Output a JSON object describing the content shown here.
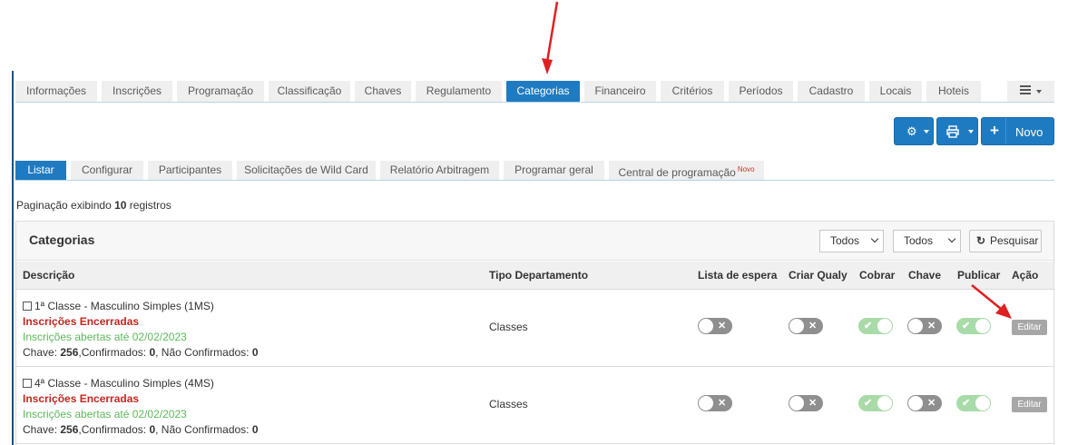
{
  "top_tabs": [
    {
      "label": "Informações",
      "active": false
    },
    {
      "label": "Inscrições",
      "active": false
    },
    {
      "label": "Programação",
      "active": false
    },
    {
      "label": "Classificação",
      "active": false
    },
    {
      "label": "Chaves",
      "active": false
    },
    {
      "label": "Regulamento",
      "active": false
    },
    {
      "label": "Categorias",
      "active": true
    },
    {
      "label": "Financeiro",
      "active": false
    },
    {
      "label": "Critérios",
      "active": false
    },
    {
      "label": "Períodos",
      "active": false
    },
    {
      "label": "Cadastro",
      "active": false
    },
    {
      "label": "Locais",
      "active": false
    },
    {
      "label": "Hoteis",
      "active": false
    }
  ],
  "toolbar": {
    "menu_icon": "hamburger-icon",
    "settings_icon": "gear-icon",
    "print_icon": "print-icon",
    "new_label": "Novo"
  },
  "sub_tabs": [
    {
      "label": "Listar",
      "active": true
    },
    {
      "label": "Configurar",
      "active": false
    },
    {
      "label": "Participantes",
      "active": false
    },
    {
      "label": "Solicitações de Wild Card",
      "active": false
    },
    {
      "label": "Relatório Arbitragem",
      "active": false
    },
    {
      "label": "Programar geral",
      "active": false
    },
    {
      "label": "Central de programação",
      "active": false,
      "badge": "Novo"
    }
  ],
  "pagination": {
    "prefix": "Paginação exibindo",
    "count": "10",
    "suffix": "registros"
  },
  "panel": {
    "title": "Categorias",
    "filter_1": "Todos",
    "filter_2": "Todos",
    "search_label": "Pesquisar"
  },
  "columns": [
    "Descrição",
    "Tipo Departamento",
    "Lista de espera",
    "Criar Qualy",
    "Cobrar",
    "Chave",
    "Publicar",
    "Ação"
  ],
  "rows": [
    {
      "name": "1ª Classe - Masculino Simples (1MS)",
      "status_closed": "Inscrições Encerradas",
      "status_open": "Inscrições abertas até 02/02/2023",
      "chave_label": "Chave:",
      "chave": "256",
      "confirmados_label": ",Confirmados:",
      "confirmados": "0",
      "nao_confirmados_label": ", Não Confirmados:",
      "nao_confirmados": "0",
      "tipo": "Classes",
      "lista_espera": false,
      "criar_qualy": false,
      "cobrar": true,
      "chave_toggle": false,
      "publicar": true,
      "action": "Editar"
    },
    {
      "name": "4ª Classe - Masculino Simples (4MS)",
      "status_closed": "Inscrições Encerradas",
      "status_open": "Inscrições abertas até 02/02/2023",
      "chave_label": "Chave:",
      "chave": "256",
      "confirmados_label": ",Confirmados:",
      "confirmados": "0",
      "nao_confirmados_label": ", Não Confirmados:",
      "nao_confirmados": "0",
      "tipo": "Classes",
      "lista_espera": false,
      "criar_qualy": false,
      "cobrar": true,
      "chave_toggle": false,
      "publicar": true,
      "action": "Editar"
    }
  ],
  "colors": {
    "primary": "#1f7bc1",
    "closed": "#c0281f",
    "open": "#5cb85c",
    "toggle_on": "#a9dba9",
    "toggle_off": "#8f8f8f",
    "annotation_arrow": "#e02020"
  }
}
